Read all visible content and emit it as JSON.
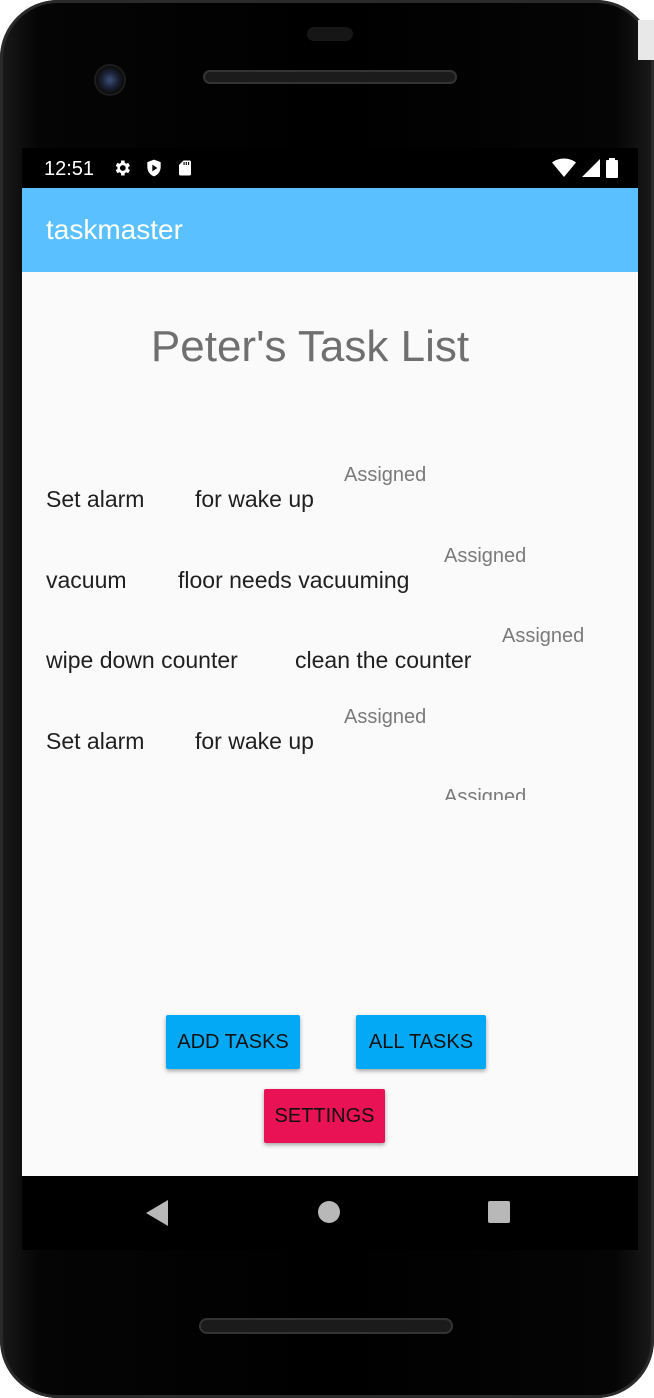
{
  "status_bar": {
    "time": "12:51",
    "left_icons": [
      "gear-icon",
      "shield-play-icon",
      "sd-card-icon"
    ],
    "right_icons": [
      "wifi-icon",
      "signal-icon",
      "battery-icon"
    ]
  },
  "app_bar": {
    "title": "taskmaster",
    "color": "#5ac0ff"
  },
  "main": {
    "page_title": "Peter's Task List",
    "tasks": [
      {
        "title": "Set alarm",
        "body": "for wake up",
        "state": "Assigned"
      },
      {
        "title": "vacuum",
        "body": "floor needs vacuuming",
        "state": "Assigned"
      },
      {
        "title": "wipe down counter",
        "body": "clean the counter",
        "state": "Assigned"
      },
      {
        "title": "Set alarm",
        "body": "for wake up",
        "state": "Assigned"
      },
      {
        "title": "",
        "body": "",
        "state": "Assigned"
      }
    ]
  },
  "buttons": {
    "add_tasks": "ADD TASKS",
    "all_tasks": "ALL TASKS",
    "settings": "SETTINGS",
    "primary_color": "#03a9f4",
    "accent_color": "#e91254"
  },
  "nav_bar": {
    "icons": [
      "back-icon",
      "home-icon",
      "recents-icon"
    ]
  }
}
